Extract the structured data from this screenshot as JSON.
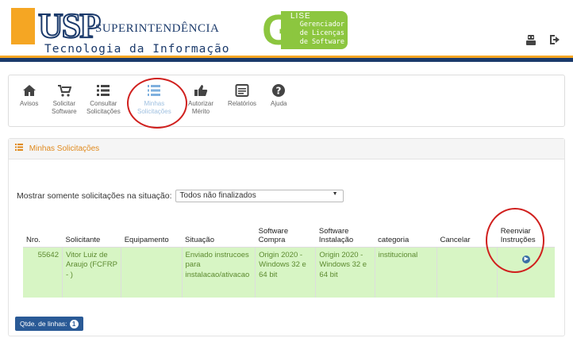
{
  "header": {
    "usp_logo_letters": "USP",
    "usp_superintendencia": "SUPERINTENDÊNCIA",
    "usp_ti": "Tecnologia da Informação",
    "lise_title": "LISE",
    "lise_subtitle_1": "Gerenciador",
    "lise_subtitle_2": "de Licenças",
    "lise_subtitle_3": "de Software"
  },
  "colors": {
    "accent_orange": "#f5a623",
    "navy": "#1b3a6b",
    "lise_green": "#8cc63f",
    "row_green": "#d7f5c4",
    "annotation_red": "#d0201e"
  },
  "toolbar": {
    "items": [
      {
        "line1": "Avisos",
        "line2": "",
        "icon": "home-icon"
      },
      {
        "line1": "Solicitar",
        "line2": "Software",
        "icon": "cart-icon"
      },
      {
        "line1": "Consultar",
        "line2": "Solicitações",
        "icon": "list-icon"
      },
      {
        "line1": "Minhas",
        "line2": "Solicitações",
        "icon": "ordered-list-icon"
      },
      {
        "line1": "Autorizar",
        "line2": "Mérito",
        "icon": "thumbs-up-icon"
      },
      {
        "line1": "Relatórios",
        "line2": "",
        "icon": "report-icon"
      },
      {
        "line1": "Ajuda",
        "line2": "",
        "icon": "question-icon"
      }
    ]
  },
  "panel": {
    "title": "Minhas Solicitações",
    "filter_label": "Mostrar somente solicitações na situação:",
    "filter_value": "Todos não finalizados"
  },
  "table": {
    "headers": [
      "Nro.",
      "Solicitante",
      "Equipamento",
      "Situação",
      "Software Compra",
      "Software Instalação",
      "categoria",
      "Cancelar",
      "Reenviar Instruções"
    ],
    "rows": [
      {
        "nro": "55642",
        "solicitante": "Vitor Luiz de Araujo (FCFRP - )",
        "equipamento": "",
        "situacao": "Enviado instrucoes para instalacao/ativacao",
        "software_compra": "Origin 2020 - Windows 32 e 64 bit",
        "software_instalacao": "Origin 2020 - Windows 32 e 64 bit",
        "categoria": "institucional",
        "cancelar": "",
        "reenviar_icon": "resend-icon"
      }
    ]
  },
  "footer": {
    "rows_button_label": "Qtde. de linhas:",
    "rows_count": "1"
  }
}
